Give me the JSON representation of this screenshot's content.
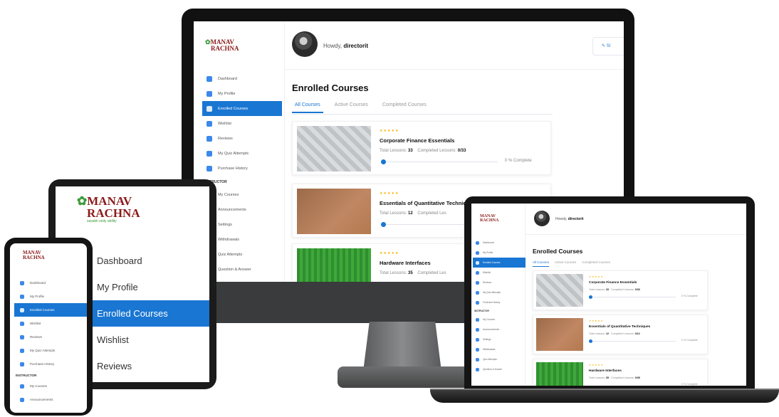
{
  "brand": {
    "line1": "MANAV",
    "line2": "RACHNA",
    "tagline": "sasakti unity ability"
  },
  "colors": {
    "accent": "#1976d2",
    "logo_red": "#8b1a1a",
    "logo_green": "#3d9a3b",
    "star": "#f5b400"
  },
  "monitor": {
    "greeting": "Howdy,",
    "username": "directorit",
    "top_button_label": "Sl",
    "sidebar": {
      "items": [
        {
          "label": "Dashboard",
          "icon": "dashboard-icon"
        },
        {
          "label": "My Profile",
          "icon": "user-icon"
        },
        {
          "label": "Enrolled Courses",
          "icon": "courses-icon"
        },
        {
          "label": "Wishlist",
          "icon": "heart-icon"
        },
        {
          "label": "Reviews",
          "icon": "star-icon"
        },
        {
          "label": "My Quiz Attempts",
          "icon": "quiz-icon"
        },
        {
          "label": "Purchase History",
          "icon": "cart-icon"
        }
      ],
      "section": "INSTRUCTOR",
      "instructor_items": [
        {
          "label": "My Courses"
        },
        {
          "label": "Announcements"
        },
        {
          "label": "Settings"
        },
        {
          "label": "Withdrawals"
        },
        {
          "label": "Quiz Attempts"
        },
        {
          "label": "Question & Answer"
        }
      ]
    },
    "page_title": "Enrolled Courses",
    "tabs": [
      "All Courses",
      "Active Courses",
      "Completed Courses"
    ],
    "courses": [
      {
        "stars": "★★★★★",
        "title": "Corporate Finance Essentials",
        "total_label": "Total Lessons:",
        "total": "33",
        "completed_label": "Completed Lessons:",
        "completed": "0/33",
        "progress_text": "0 % Complete",
        "progress": 0
      },
      {
        "stars": "★★★★★",
        "title": "Essentials of Quantitative Techniques",
        "total_label": "Total Lessons:",
        "total": "12",
        "completed_label": "Completed Les",
        "completed": "",
        "progress_text": "",
        "progress": 0
      },
      {
        "stars": "★★★★★",
        "title": "Hardware Interfaces",
        "total_label": "Total Lessons:",
        "total": "35",
        "completed_label": "Completed Les",
        "completed": "",
        "progress_text": "",
        "progress": 0
      }
    ]
  },
  "tablet": {
    "items": [
      "Dashboard",
      "My Profile",
      "Enrolled Courses",
      "Wishlist",
      "Reviews"
    ]
  },
  "phone": {
    "items": [
      "Dashboard",
      "My Profile",
      "Enrolled Courses",
      "Wishlist",
      "Reviews",
      "My Quiz Attempts",
      "Purchase History"
    ],
    "section": "INSTRUCTOR",
    "instructor_items": [
      "My Courses",
      "Announcements"
    ]
  },
  "laptop": {
    "greeting": "Howdy,",
    "username": "directorit",
    "page_title": "Enrolled Courses",
    "tabs": [
      "All Courses",
      "Active Courses",
      "Completed Courses"
    ],
    "sidebar_section": "INSTRUCTOR",
    "courses": [
      {
        "title": "Corporate Finance Essentials",
        "total": "33",
        "completed": "0/33",
        "progress_text": "0 % Complete"
      },
      {
        "title": "Essentials of Quantitative Techniques",
        "total": "12",
        "completed": "0/12",
        "progress_text": "0 % Complete"
      },
      {
        "title": "Hardware Interfaces",
        "total": "35",
        "completed": "0/35",
        "progress_text": "0 % Complete"
      }
    ]
  }
}
